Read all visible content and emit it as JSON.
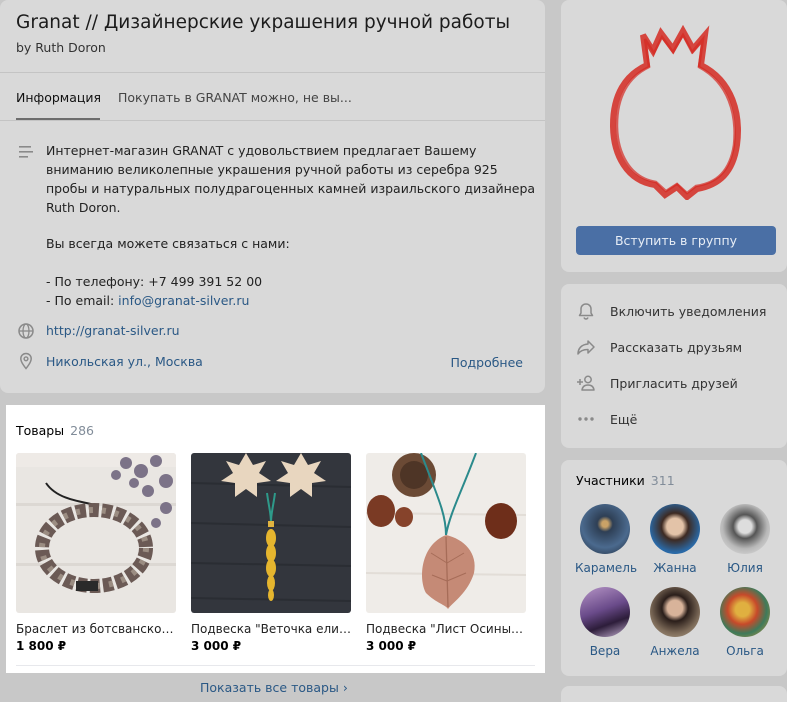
{
  "group": {
    "title": "Granat // Дизайнерские украшения ручной работы",
    "byline": "by Ruth Doron"
  },
  "tabs": [
    {
      "label": "Информация"
    },
    {
      "label": "Покупать в GRANAT можно, не вы..."
    }
  ],
  "info": {
    "description": "Интернет-магазин GRANAT с удовольствием предлагает Вашему вниманию великолепные украшения ручной работы из серебра 925 пробы и натуральных полудрагоценных камней израильского дизайнера Ruth Doron.",
    "contact_intro": "Вы всегда можете связаться с нами:",
    "phone_line": "- По телефону: +7 499 391 52 00",
    "email_prefix": "- По email: ",
    "email": "info@granat-silver.ru",
    "website": "http://granat-silver.ru",
    "address": "Никольская ул., Москва",
    "more_link": "Подробнее"
  },
  "goods": {
    "title": "Товары",
    "count": "286",
    "items": [
      {
        "name": "Браслет из ботсванског...",
        "price": "1 800 ₽"
      },
      {
        "name": "Подвеска \"Веточка ели\"...",
        "price": "3 000 ₽"
      },
      {
        "name": "Подвеска \"Лист Осины\"...",
        "price": "3 000 ₽"
      }
    ],
    "show_all": "Показать все товары ›"
  },
  "sidebar": {
    "join_button": "Вступить в группу",
    "actions": [
      {
        "label": "Включить уведомления",
        "icon": "bell-icon"
      },
      {
        "label": "Рассказать друзьям",
        "icon": "share-icon"
      },
      {
        "label": "Пригласить друзей",
        "icon": "add-user-icon"
      },
      {
        "label": "Ещё",
        "icon": "more-icon"
      }
    ],
    "members_title": "Участники",
    "members_count": "311",
    "members": [
      {
        "name": "Карамель"
      },
      {
        "name": "Жанна"
      },
      {
        "name": "Юлия"
      },
      {
        "name": "Вера"
      },
      {
        "name": "Анжела"
      },
      {
        "name": "Ольга"
      }
    ]
  },
  "colors": {
    "link": "#2a5885",
    "join_button": "#4a6fa5",
    "logo_red": "#d42a22"
  }
}
